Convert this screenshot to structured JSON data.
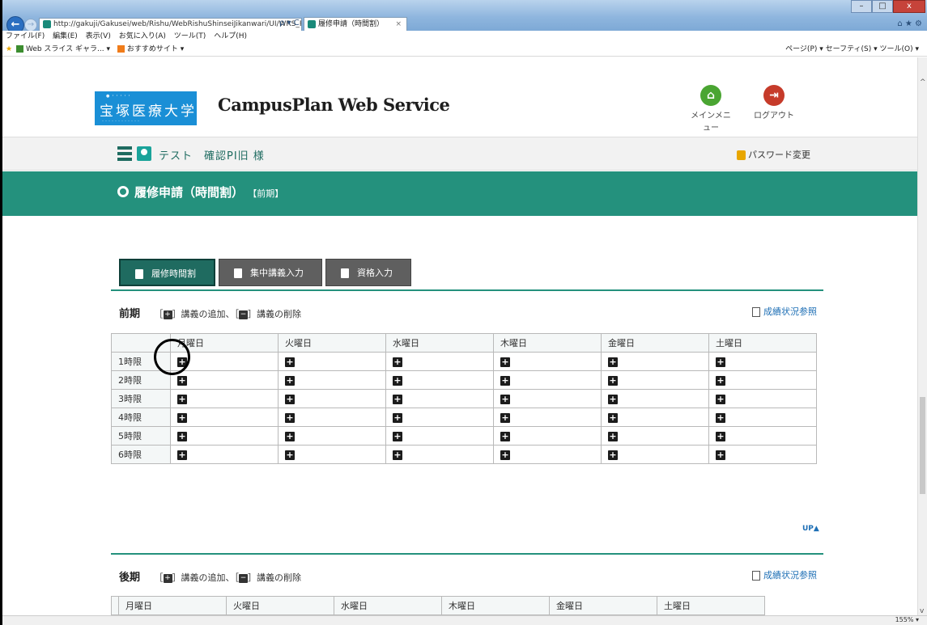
{
  "browser": {
    "address": "http://gakuji/Gakusei/web/Rishu/WebRishuShinseiJikanwari/UI/WRS_RishuShin",
    "address_host": "gakuji",
    "address_tools": "ρ ▾ C",
    "tab_title": "履修申請（時間割）",
    "tab_close": "×",
    "window_buttons": [
      "–",
      "□",
      "x"
    ],
    "right_tools": "⌂ ★ ⚙",
    "menu": [
      "ファイル(F)",
      "編集(E)",
      "表示(V)",
      "お気に入り(A)",
      "ツール(T)",
      "ヘルプ(H)"
    ],
    "favorites": [
      "Web スライス ギャラ... ▾",
      "おすすめサイト ▾"
    ],
    "command_bar": "ページ(P) ▾  セーフティ(S) ▾  ツール(O) ▾",
    "zoom": "155%"
  },
  "header": {
    "logo_text": "宝塚医療大学",
    "site_name": "CampusPlan Web Service",
    "main_menu_label": "メインメニュー",
    "logout_label": "ログアウト"
  },
  "userbar": {
    "user_name": "テスト　確認PI旧 様",
    "password_change": "パスワード変更"
  },
  "page": {
    "title": "履修申請（時間割）",
    "term_tag": "【前期】"
  },
  "tabs": [
    "履修時間割",
    "集中講義入力",
    "資格入力"
  ],
  "legend": {
    "open_bracket": "［",
    "add_text": "］講義の追加、［",
    "remove_text": "］講義の削除"
  },
  "grade_ref": "成績状況参照",
  "up_label": "UP",
  "days": [
    "月曜日",
    "火曜日",
    "水曜日",
    "木曜日",
    "金曜日",
    "土曜日"
  ],
  "sections": [
    {
      "title": "前期",
      "periods": [
        "1時限",
        "2時限",
        "3時限",
        "4時限",
        "5時限",
        "6時限"
      ]
    },
    {
      "title": "後期",
      "periods": []
    }
  ]
}
